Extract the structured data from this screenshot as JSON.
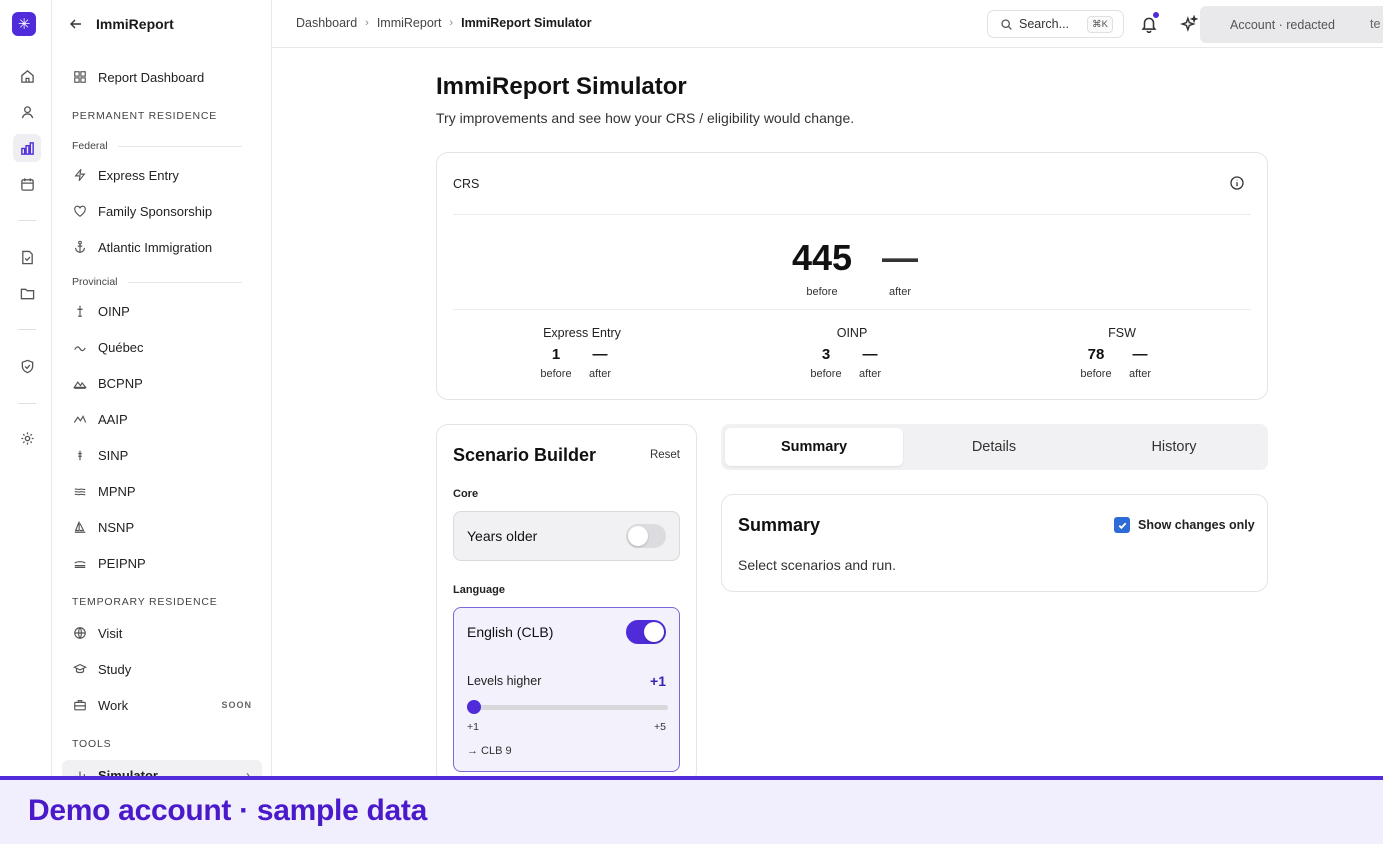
{
  "app": {
    "title": "ImmiReport"
  },
  "rail": {
    "icons": [
      "home-icon",
      "user-icon",
      "chart-icon",
      "calendar-icon",
      "document-check-icon",
      "folder-icon",
      "shield-check-icon",
      "gear-icon"
    ]
  },
  "sidebar": {
    "report_dashboard": "Report Dashboard",
    "permanent_section": "PERMANENT RESIDENCE",
    "federal_label": "Federal",
    "federal_items": [
      "Express Entry",
      "Family Sponsorship",
      "Atlantic Immigration"
    ],
    "provincial_label": "Provincial",
    "provincial_items": [
      "OINP",
      "Québec",
      "BCPNP",
      "AAIP",
      "SINP",
      "MPNP",
      "NSNP",
      "PEIPNP"
    ],
    "temporary_section": "TEMPORARY RESIDENCE",
    "temporary_items": [
      "Visit",
      "Study",
      "Work"
    ],
    "work_badge": "SOON",
    "tools_section": "TOOLS",
    "tools_items": [
      "Simulator"
    ]
  },
  "breadcrumb": [
    "Dashboard",
    "ImmiReport",
    "ImmiReport Simulator"
  ],
  "search": {
    "placeholder": "Search...",
    "shortcut": "⌘K"
  },
  "account": {
    "label": "Account · redacted",
    "trail": "te"
  },
  "page": {
    "title": "ImmiReport Simulator",
    "subtitle": "Try improvements and see how your CRS / eligibility would change."
  },
  "crs": {
    "label": "CRS",
    "before": "445",
    "after": "—",
    "before_label": "before",
    "after_label": "after",
    "programs": [
      {
        "name": "Express Entry",
        "before": "1",
        "after": "—"
      },
      {
        "name": "OINP",
        "before": "3",
        "after": "—"
      },
      {
        "name": "FSW",
        "before": "78",
        "after": "—"
      }
    ]
  },
  "builder": {
    "title": "Scenario Builder",
    "reset": "Reset",
    "core_label": "Core",
    "years_older": "Years older",
    "years_older_on": false,
    "language_label": "Language",
    "english": "English (CLB)",
    "english_on": true,
    "levels_higher": "Levels higher",
    "levels_value": "+1",
    "slider_min": "+1",
    "slider_max": "+5",
    "slider_level": 0,
    "clb_result": "→ CLB 9"
  },
  "tabs": [
    "Summary",
    "Details",
    "History"
  ],
  "summary": {
    "title": "Summary",
    "show_changes": "Show changes only",
    "show_changes_checked": true,
    "text": "Select scenarios and run."
  },
  "banner": {
    "text": "Demo account · sample data"
  },
  "colors": {
    "accent": "#4f2bd9",
    "banner_text": "#4a19c9",
    "banner_bg": "#f1effd",
    "checkbox": "#2f6bd6"
  }
}
